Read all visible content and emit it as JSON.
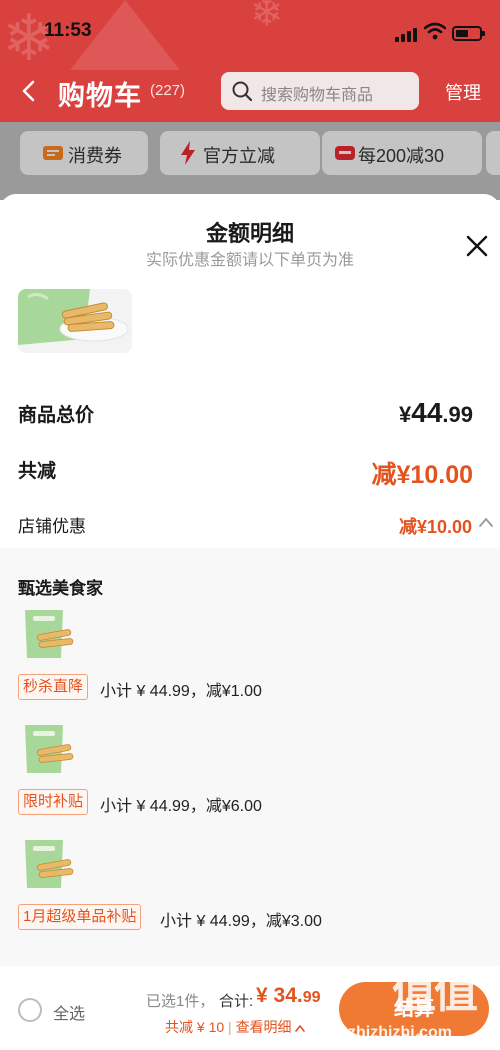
{
  "status_bar": {
    "time": "11:53"
  },
  "nav": {
    "title": "购物车",
    "count": "(227)",
    "search_placeholder": "搜索购物车商品",
    "manage": "管理"
  },
  "promo_chips": [
    {
      "label": "消费券",
      "icon": "coupon-icon"
    },
    {
      "label": "官方立减",
      "icon": "lightning-icon"
    },
    {
      "label": "每200减30",
      "icon": "discount-icon"
    }
  ],
  "sheet": {
    "title": "金额明细",
    "subtitle": "实际优惠金额请以下单页为准",
    "total_label": "商品总价",
    "total_value": {
      "yen": "¥",
      "int": "44",
      "dec": ".99"
    },
    "reduce_label": "共减",
    "reduce_value": "减¥10.00",
    "store_label": "店铺优惠",
    "store_value": "减¥10.00",
    "shop_name": "甄选美食家",
    "items": [
      {
        "tag": "秒杀直降",
        "subtotal": "小计 ¥ 44.99，减¥1.00"
      },
      {
        "tag": "限时补贴",
        "subtotal": "小计 ¥ 44.99，减¥6.00"
      },
      {
        "tag": "1月超级单品补贴",
        "subtotal": "小计 ¥ 44.99，减¥3.00"
      }
    ]
  },
  "bottom_bar": {
    "select_all": "全选",
    "selected_count": "已选1件，",
    "total_label": "合计:",
    "grand_int": "¥ 34.",
    "grand_dec": "99",
    "saved": "共减 ¥ 10",
    "separator": "|",
    "view_detail": "查看明细",
    "checkout": "结算"
  },
  "watermark": {
    "glyphs": "值值值",
    "url": "zhizhizhi.com"
  },
  "colors": {
    "header_red": "#d9413f",
    "accent_orange": "#e2541f",
    "checkout_orange": "#f07a33"
  }
}
